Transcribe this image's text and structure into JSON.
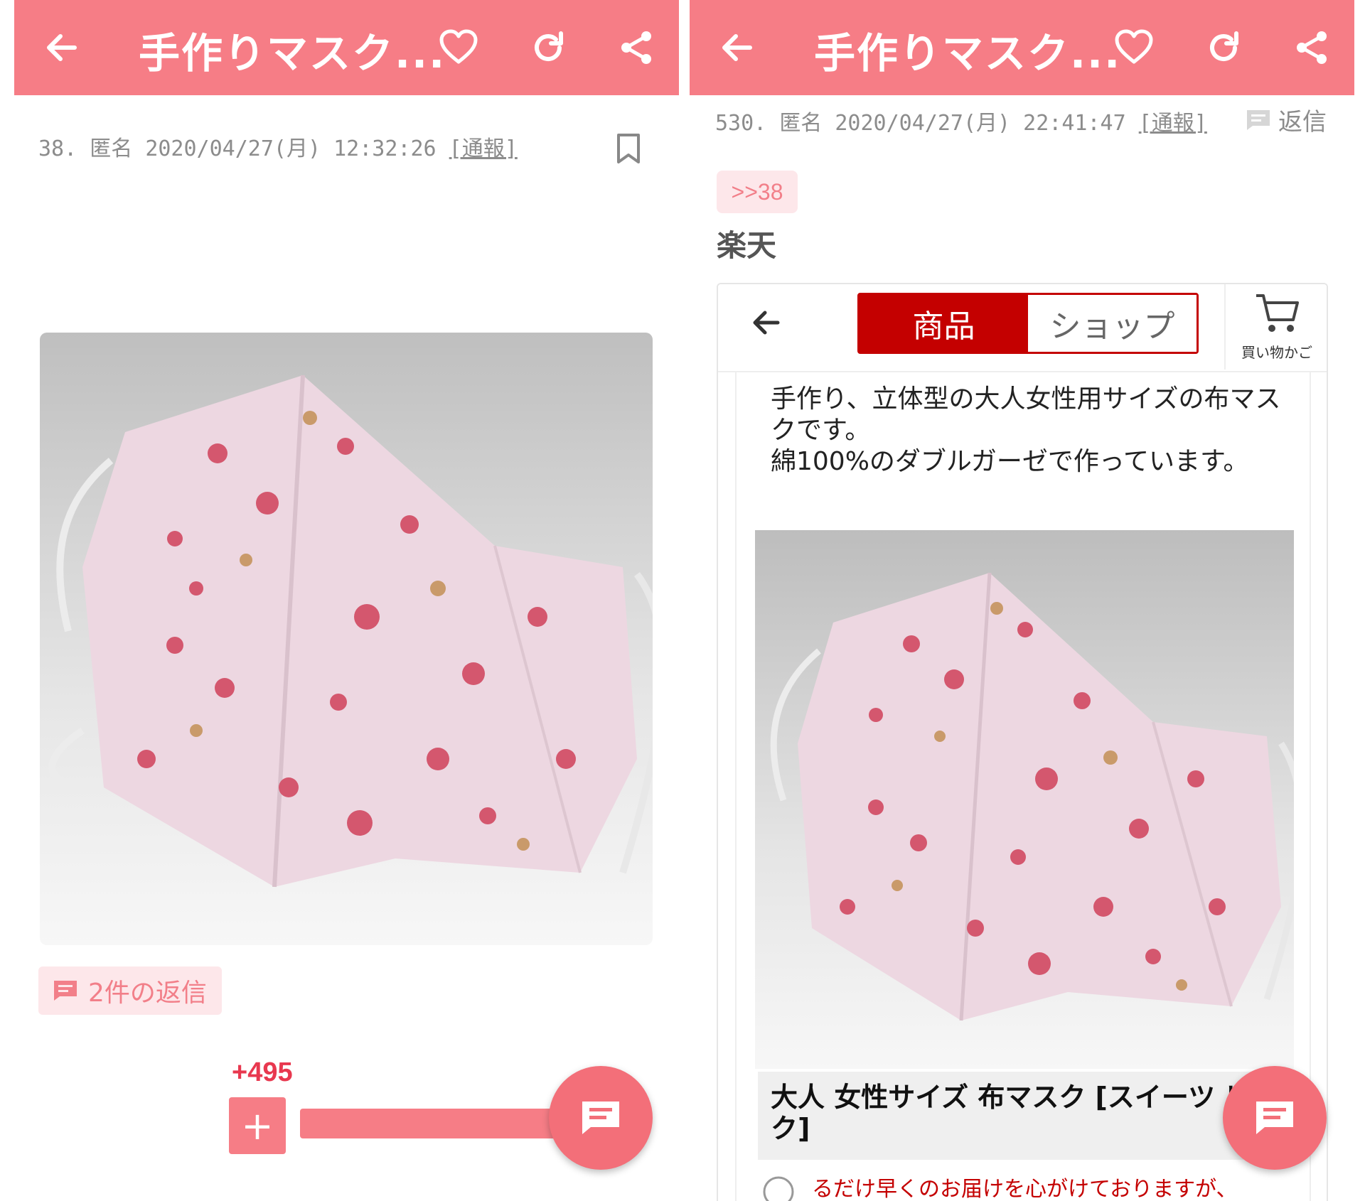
{
  "colors": {
    "accent": "#f67d86",
    "accent_light": "#fde7ea",
    "rakuten_red": "#c40000"
  },
  "left": {
    "header": {
      "title": "手作りマスク...",
      "icons": [
        "back-arrow-icon",
        "heart-icon",
        "refresh-icon",
        "share-icon"
      ]
    },
    "post": {
      "number": "38.",
      "author": "匿名",
      "timestamp": "2020/04/27(月) 12:32:26",
      "report_label": "[通報]",
      "reply_count_label": "2件の返信",
      "vote_count": "+495",
      "plus_label": "+"
    }
  },
  "right": {
    "header": {
      "title": "手作りマスク...",
      "icons": [
        "back-arrow-icon",
        "heart-icon",
        "refresh-icon",
        "share-icon"
      ]
    },
    "post": {
      "number": "530.",
      "author": "匿名",
      "timestamp": "2020/04/27(月) 22:41:47",
      "report_label": "[通報]",
      "reply_label": "返信",
      "anchor": ">>38",
      "text": "楽天"
    },
    "embed": {
      "tab_product": "商品",
      "tab_shop": "ショップ",
      "cart_label": "買い物かご",
      "description_line1": "手作り、立体型の大人女性用サイズの布マスクです。",
      "description_line2": "綿100%のダブルガーゼで作っています。",
      "item_title": "大人 女性サイズ 布マスク [スイーツ ピンク]",
      "notice": "るだけ早くのお届けを心がけておりますが、"
    }
  }
}
